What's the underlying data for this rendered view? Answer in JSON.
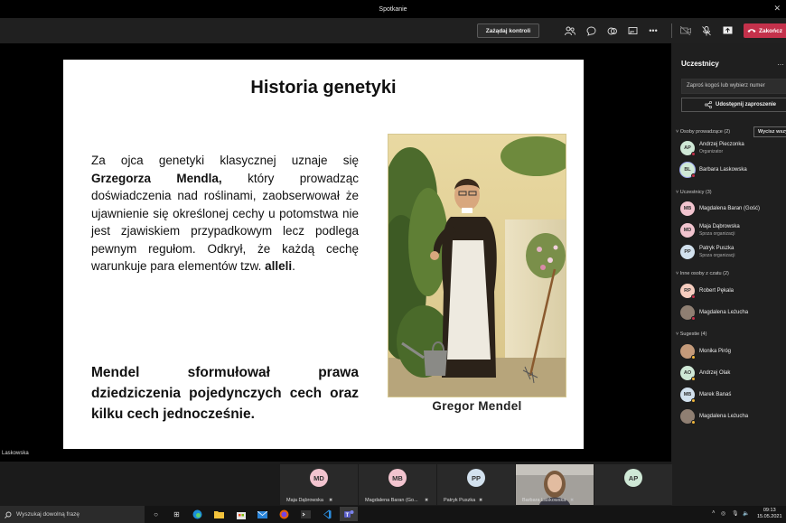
{
  "window": {
    "title": "Spotkanie"
  },
  "toolbar": {
    "request_control": "Zażądaj kontroli",
    "end_label": "Zakończ"
  },
  "slide": {
    "title": "Historia genetyki",
    "para_1": "Za ojca genetyki klasycznej uznaje się",
    "para_bold": "Grzegorza Mendla,",
    "para_2": "który prowadząc doświadczenia nad roślinami, zaobserwował że ujawnienie się określonej cechy u potomstwa nie jest zjawiskiem przypadkowym lecz podlega pewnym regułom. Odkrył, że każdą cechę warunkuje para elementów tzw.",
    "para_bold_2": "alleli",
    "para_end": ".",
    "conclusion": "Mendel sformułował prawa dziedziczenia pojedynczych cech oraz kilku cech jednocześnie.",
    "caption": "Gregor Mendel"
  },
  "presenter_label": "Laskowska",
  "gallery": [
    {
      "initials": "MD",
      "name": "Maja Dąbrowska",
      "color": "#f2c4cf"
    },
    {
      "initials": "MB",
      "name": "Magdalena Baran (Go...",
      "color": "#f2c4cf"
    },
    {
      "initials": "PP",
      "name": "Patryk Puszka",
      "color": "#d2e1ee"
    },
    {
      "initials": "",
      "name": "Barbara Laskowska",
      "color": "#8d8a86"
    },
    {
      "initials": "AP",
      "name": "",
      "color": "#cfe8d6"
    }
  ],
  "panel": {
    "title": "Uczestnicy",
    "invite_placeholder": "Zaproś kogoś lub wybierz numer",
    "share_invite": "Udostępnij zaproszenie",
    "mute_all": "Wycisz wszystkich",
    "sections": [
      {
        "label": "Osoby prowadzące (2)",
        "people": [
          {
            "initials": "AP",
            "name": "Andrzej Pieczonka",
            "role": "Organizator",
            "color": "#cfe8d6",
            "status": "#c4314b"
          },
          {
            "initials": "BL",
            "name": "Barbara Laskowska",
            "role": "",
            "color": "#cfe8d6",
            "status": "#c4314b"
          }
        ]
      },
      {
        "label": "Uczestnicy (3)",
        "people": [
          {
            "initials": "MB",
            "name": "Magdalena Baran (Gość)",
            "role": "",
            "color": "#f2c4cf",
            "status": ""
          },
          {
            "initials": "MD",
            "name": "Maja Dąbrowska",
            "role": "Spoza organizacji",
            "color": "#f2c4cf",
            "status": ""
          },
          {
            "initials": "PP",
            "name": "Patryk Puszka",
            "role": "Spoza organizacji",
            "color": "#d2e1ee",
            "status": ""
          }
        ]
      },
      {
        "label": "Inne osoby z czatu (2)",
        "people": [
          {
            "initials": "RP",
            "name": "Robert Pękala",
            "role": "",
            "color": "#f6cdbf",
            "status": "#c4314b"
          },
          {
            "initials": "",
            "name": "Magdalena Leżucha",
            "role": "",
            "color": "#8f7f72",
            "status": "#c4314b"
          }
        ]
      },
      {
        "label": "Sugestie (4)",
        "people": [
          {
            "initials": "",
            "name": "Monika Piróg",
            "role": "",
            "color": "#c49a7a",
            "status": "#f0b53a"
          },
          {
            "initials": "AO",
            "name": "Andrzej Olak",
            "role": "",
            "color": "#cfe8d6",
            "status": "#f0b53a"
          },
          {
            "initials": "MB",
            "name": "Marek Banaś",
            "role": "",
            "color": "#d2e1ee",
            "status": "#f0b53a"
          },
          {
            "initials": "",
            "name": "Magdalena Leżucha",
            "role": "",
            "color": "#8f7f72",
            "status": "#f0b53a"
          }
        ]
      }
    ]
  },
  "taskbar": {
    "search_placeholder": "Wyszukaj dowolną frazę",
    "time": "09:13",
    "date": "15.05.2021"
  }
}
